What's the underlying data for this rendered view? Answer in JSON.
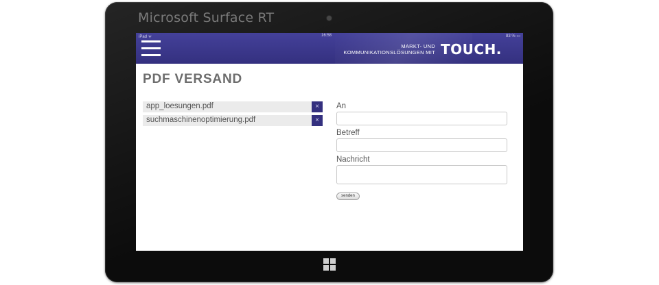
{
  "device": {
    "brand": "Microsoft Surface RT"
  },
  "status_bar": {
    "left": "iPad ᯤ",
    "time": "16:58",
    "right": "83 % ▭"
  },
  "header": {
    "tagline_line1": "MARKT- UND",
    "tagline_line2": "KOMMUNIKATIONSLÖSUNGEN MIT",
    "logo": "TOUCH.",
    "menu_icon": "hamburger-menu-icon",
    "bar_color": "#3a3688"
  },
  "page": {
    "title": "PDF VERSAND"
  },
  "files": [
    {
      "name": "app_loesungen.pdf",
      "remove_label": "×"
    },
    {
      "name": "suchmaschinenoptimierung.pdf",
      "remove_label": "×"
    }
  ],
  "form": {
    "to_label": "An",
    "to_value": "",
    "subject_label": "Betreff",
    "subject_value": "",
    "message_label": "Nachricht",
    "message_value": "",
    "send_label": "senden"
  }
}
